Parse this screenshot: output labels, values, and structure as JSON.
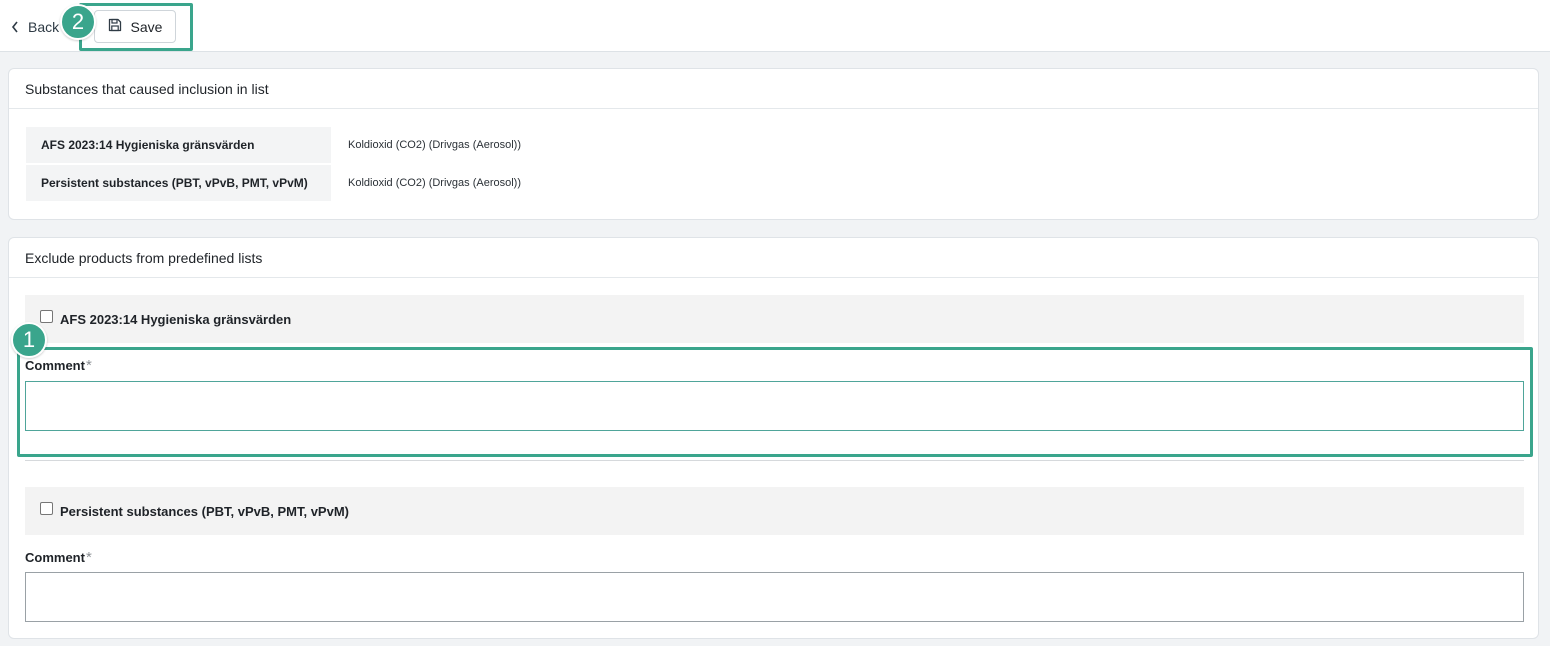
{
  "toolbar": {
    "back_label": "Back",
    "save_label": "Save"
  },
  "annotations": {
    "badge1": "1",
    "badge2": "2",
    "color": "#3aa58c"
  },
  "inclusion": {
    "title": "Substances that caused inclusion in list",
    "rows": [
      {
        "list": "AFS 2023:14 Hygieniska gränsvärden",
        "substance": "Koldioxid (CO2) (Drivgas (Aerosol))"
      },
      {
        "list": "Persistent substances (PBT, vPvB, PMT, vPvM)",
        "substance": "Koldioxid (CO2) (Drivgas (Aerosol))"
      }
    ]
  },
  "exclude": {
    "title": "Exclude products from predefined lists",
    "items": [
      {
        "label": "AFS 2023:14 Hygieniska gränsvärden",
        "checked": false,
        "comment_label": "Comment",
        "required_mark": "*",
        "comment_value": ""
      },
      {
        "label": "Persistent substances (PBT, vPvB, PMT, vPvM)",
        "checked": false,
        "comment_label": "Comment",
        "required_mark": "*",
        "comment_value": ""
      }
    ]
  },
  "icons": {
    "back": "chevron-left-icon",
    "save": "floppy-disk-icon"
  }
}
